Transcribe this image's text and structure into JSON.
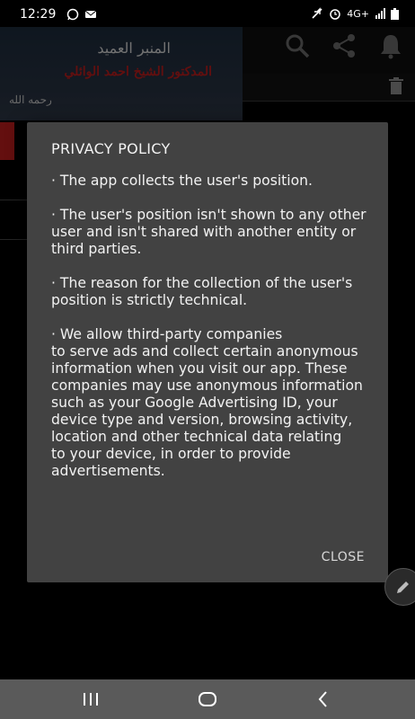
{
  "status_bar": {
    "time": "12:29",
    "network": "4G+"
  },
  "banner": {
    "title": "المنبر العميد",
    "subtitle": "المدكتور الشيخ احمد الوائلي",
    "caption": "رحمه الله"
  },
  "toolbar": {
    "icons": [
      "search-icon",
      "share-icon",
      "notification-bell-icon",
      "trash-icon"
    ]
  },
  "dialog": {
    "title": "PRIVACY POLICY",
    "paragraphs": [
      "  · The app collects the user's position.",
      "· The user's position isn't shown to any other user and isn't shared with another entity or third parties.",
      "· The reason for the collection of the user's position is strictly technical.",
      "· We allow third-party companies\nto serve ads and collect certain anonymous information when you visit our app. These companies may use anonymous information such as your Google Advertising ID, your device type and version, browsing activity, location and other technical data relating\nto your device, in order to provide advertisements."
    ],
    "close_label": "CLOSE"
  },
  "colors": {
    "dialog_bg": "#424242",
    "accent_red": "#b71c1c",
    "nav_bar": "#5a5a5a"
  }
}
